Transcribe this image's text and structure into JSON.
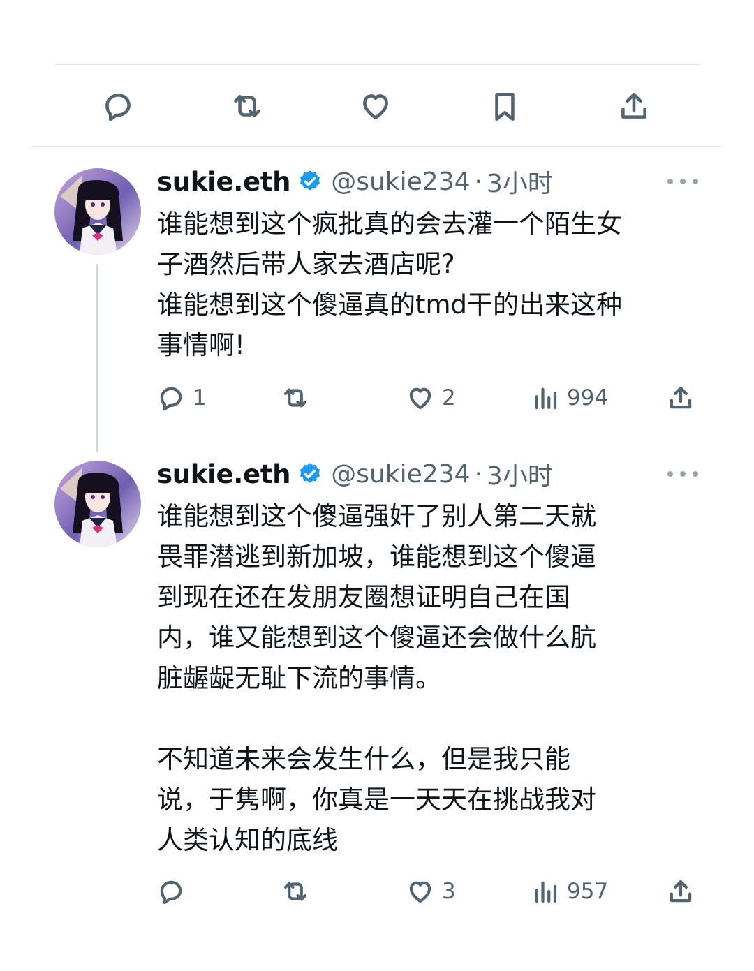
{
  "top_actions": {
    "icons": [
      "reply-icon",
      "retweet-icon",
      "like-icon",
      "bookmark-icon",
      "share-icon"
    ]
  },
  "tweets": [
    {
      "name": "sukie.eth",
      "handle": "@sukie234",
      "separator": "·",
      "time": "3小时",
      "text": "谁能想到这个疯批真的会去灌一个陌生女\n子酒然后带人家去酒店呢?\n谁能想到这个傻逼真的tmd干的出来这种\n事情啊!",
      "stats": {
        "replies": "1",
        "retweets": "",
        "likes": "2",
        "views": "994"
      }
    },
    {
      "name": "sukie.eth",
      "handle": "@sukie234",
      "separator": "·",
      "time": "3小时",
      "text": "谁能想到这个傻逼强奸了别人第二天就\n畏罪潜逃到新加坡，谁能想到这个傻逼\n到现在还在发朋友圈想证明自己在国\n内，谁又能想到这个傻逼还会做什么肮\n脏龌龊无耻下流的事情。\n\n不知道未来会发生什么，但是我只能\n说，于隽啊，你真是一天天在挑战我对\n人类认知的底线",
      "stats": {
        "replies": "",
        "retweets": "",
        "likes": "3",
        "views": "957"
      }
    }
  ],
  "colors": {
    "text": "#0f1419",
    "secondary": "#536471",
    "verified": "#1d9bf0",
    "divider": "#e6e9ec"
  }
}
